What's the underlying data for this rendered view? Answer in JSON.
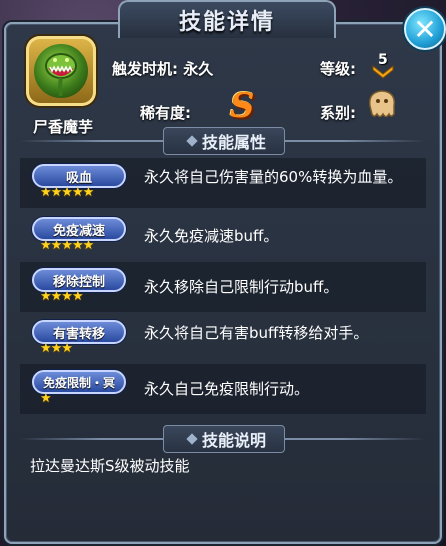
{
  "dialog": {
    "title": "技能详情",
    "close_icon": "close-x-icon"
  },
  "skill": {
    "name": "尸香魔芋",
    "icon": "carnivorous-plant-icon",
    "trigger_label": "触发时机:",
    "trigger_value": "永久",
    "level_label": "等级:",
    "level_value": "5",
    "rarity_label": "稀有度:",
    "rarity_value": "S",
    "category_label": "系别:",
    "category_icon": "ghost-type-icon"
  },
  "attributes_section": {
    "title": "技能属性",
    "items": [
      {
        "name": "吸血",
        "stars": 5,
        "star_glyphs": "★★★★★",
        "desc": "永久将自己伤害量的60%转换为血量。"
      },
      {
        "name": "免疫减速",
        "stars": 5,
        "star_glyphs": "★★★★★",
        "desc": "永久免疫减速buff。"
      },
      {
        "name": "移除控制",
        "stars": 4,
        "star_glyphs": "★★★★",
        "desc": "永久移除自己限制行动buff。"
      },
      {
        "name": "有害转移",
        "stars": 3,
        "star_glyphs": "★★★",
        "desc": "永久将自己有害buff转移给对手。"
      },
      {
        "name": "免疫限制・冥",
        "stars": 1,
        "star_glyphs": "★",
        "desc": "永久自己免疫限制行动。"
      }
    ]
  },
  "description_section": {
    "title": "技能说明",
    "text": "拉达曼达斯S级被动技能"
  },
  "colors": {
    "badge_blue": "#2a4aa0",
    "star_gold": "#ffd21e",
    "rarity_orange": "#ff8a1a",
    "close_cyan": "#1f9fd6"
  }
}
